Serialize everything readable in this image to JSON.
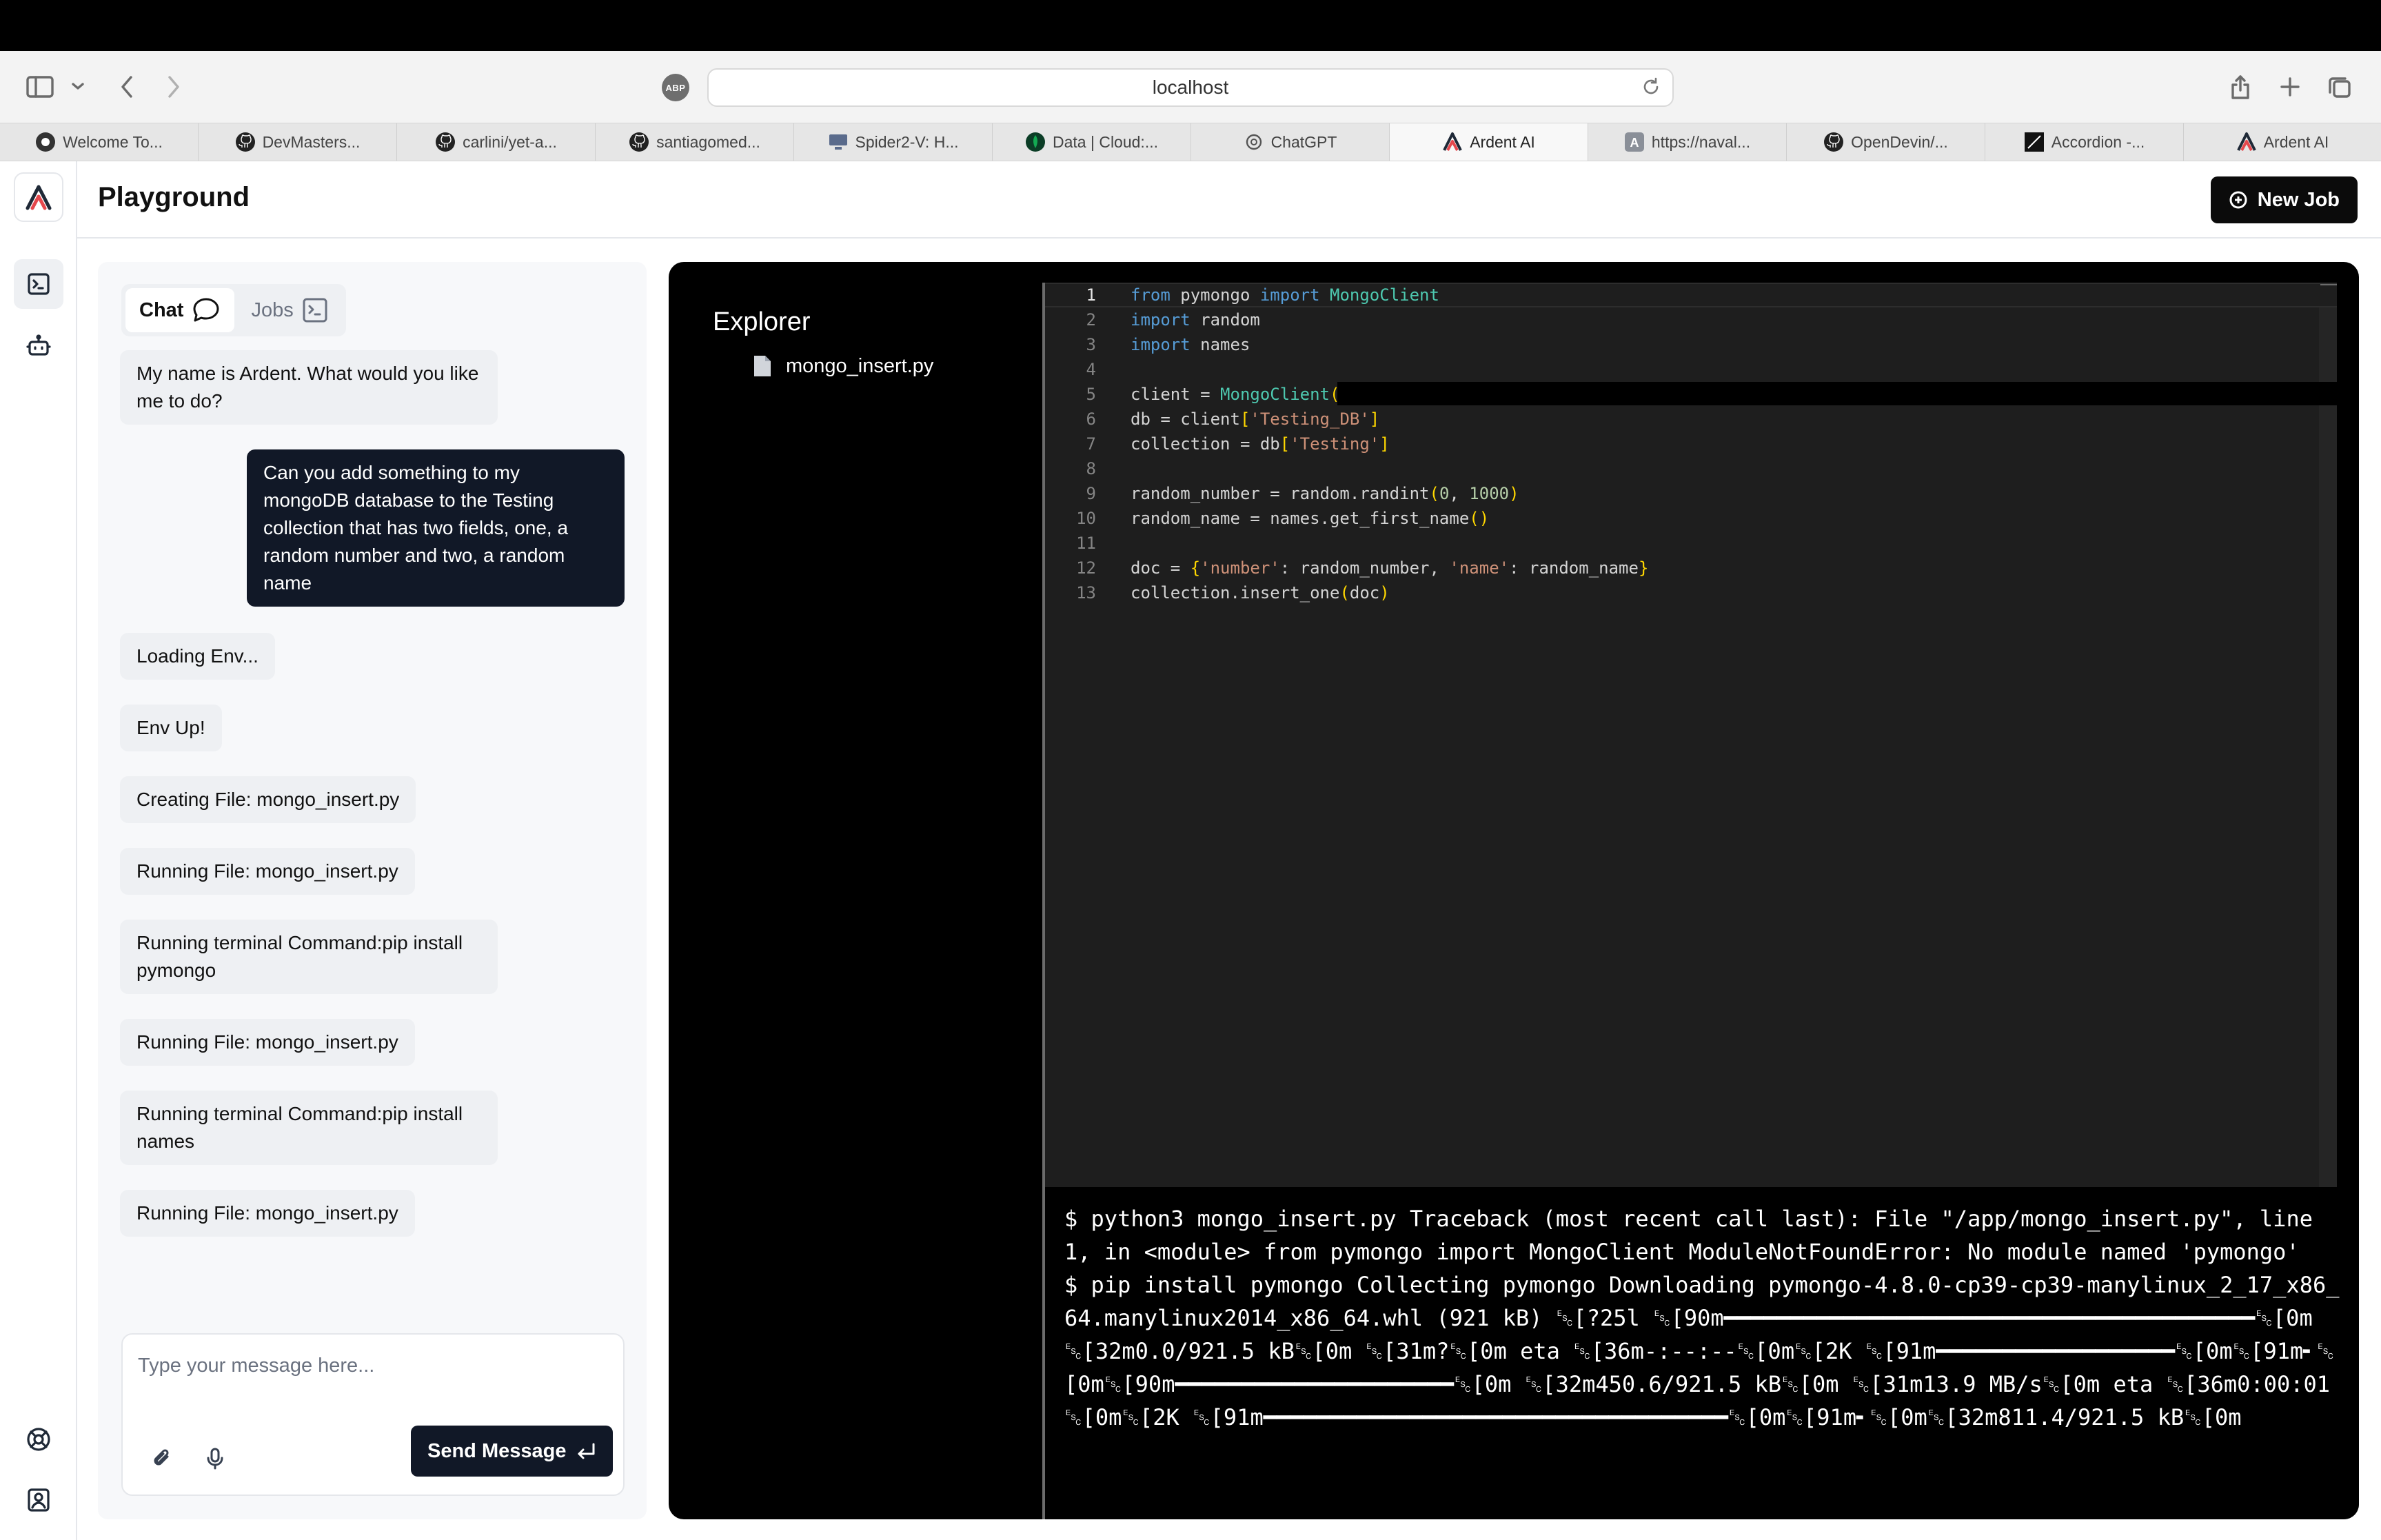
{
  "browser": {
    "url": "localhost",
    "adblock_label": "ABP",
    "tabs": [
      {
        "label": "Welcome To...",
        "icon": "dark-circle-icon"
      },
      {
        "label": "DevMasters...",
        "icon": "github-icon"
      },
      {
        "label": "carlini/yet-a...",
        "icon": "github-icon"
      },
      {
        "label": "santiagomed...",
        "icon": "github-icon"
      },
      {
        "label": "Spider2-V: H...",
        "icon": "monitor-icon"
      },
      {
        "label": "Data | Cloud:...",
        "icon": "mongodb-leaf-icon"
      },
      {
        "label": "ChatGPT",
        "icon": "openai-icon"
      },
      {
        "label": "Ardent AI",
        "icon": "ardent-logo-icon"
      },
      {
        "label": "https://naval...",
        "icon": "letter-a-icon"
      },
      {
        "label": "OpenDevin/...",
        "icon": "github-icon"
      },
      {
        "label": "Accordion -...",
        "icon": "slash-icon"
      },
      {
        "label": "Ardent AI",
        "icon": "ardent-logo-icon"
      }
    ]
  },
  "header": {
    "title": "Playground",
    "new_job_label": "New Job"
  },
  "chat": {
    "tab_chat": "Chat",
    "tab_jobs": "Jobs",
    "messages": [
      {
        "role": "bot",
        "text": "My name is Ardent. What would you like me to do?"
      },
      {
        "role": "user",
        "text": "Can you add something to my mongoDB database to the Testing collection that has two fields, one, a random number and two, a random name"
      },
      {
        "role": "bot",
        "text": "Loading Env..."
      },
      {
        "role": "bot",
        "text": "Env Up!"
      },
      {
        "role": "bot",
        "text": "Creating File: mongo_insert.py"
      },
      {
        "role": "bot",
        "text": "Running File: mongo_insert.py"
      },
      {
        "role": "bot",
        "text": "Running terminal Command:pip install pymongo"
      },
      {
        "role": "bot",
        "text": "Running File: mongo_insert.py"
      },
      {
        "role": "bot",
        "text": "Running terminal Command:pip install names"
      },
      {
        "role": "bot",
        "text": "Running File: mongo_insert.py"
      }
    ],
    "input_placeholder": "Type your message here...",
    "send_label": "Send Message"
  },
  "explorer": {
    "title": "Explorer",
    "files": [
      "mongo_insert.py"
    ]
  },
  "editor": {
    "current_line": 1,
    "line_numbers": [
      "1",
      "2",
      "3",
      "4",
      "5",
      "6",
      "7",
      "8",
      "9",
      "10",
      "11",
      "12",
      "13"
    ],
    "lines": [
      "from pymongo import MongoClient",
      "import random",
      "import names",
      "",
      "client = MongoClient(",
      "db = client['Testing_DB']",
      "collection = db['Testing']",
      "",
      "random_number = random.randint(0, 1000)",
      "random_name = names.get_first_name()",
      "",
      "doc = {'number': random_number, 'name': random_name}",
      "collection.insert_one(doc)"
    ]
  },
  "terminal": {
    "output": "$ python3 mongo_insert.py Traceback (most recent call last): File \"/app/mongo_insert.py\", line 1, in <module> from pymongo import MongoClient ModuleNotFoundError: No module named 'pymongo'\n$ pip install pymongo Collecting pymongo Downloading pymongo-4.8.0-cp39-cp39-manylinux_2_17_x86_64.manylinux2014_x86_64.whl (921 kB) ␛[?25l ␛[90m━━━━━━━━━━━━━━━━━━━━━━━━━━━━━━━━━━━━━━━━␛[0m ␛[32m0.0/921.5 kB␛[0m ␛[31m?␛[0m eta ␛[36m-:--:--␛[0m␛[2K ␛[91m━━━━━━━━━━━━━━━━━━␛[0m␛[91m╸␛[0m␛[90m━━━━━━━━━━━━━━━━━━━━━␛[0m ␛[32m450.6/921.5 kB␛[0m ␛[31m13.9 MB/s␛[0m eta ␛[36m0:00:01␛[0m␛[2K ␛[91m━━━━━━━━━━━━━━━━━━━━━━━━━━━━━━━━━━━␛[0m␛[91m╸␛[0m␛[32m811.4/921.5 kB␛[0m"
  },
  "colors": {
    "accent_dark": "#111827",
    "ide_background": "#000000",
    "editor_background": "#1e1e1e",
    "brand_red": "#e5484d"
  }
}
